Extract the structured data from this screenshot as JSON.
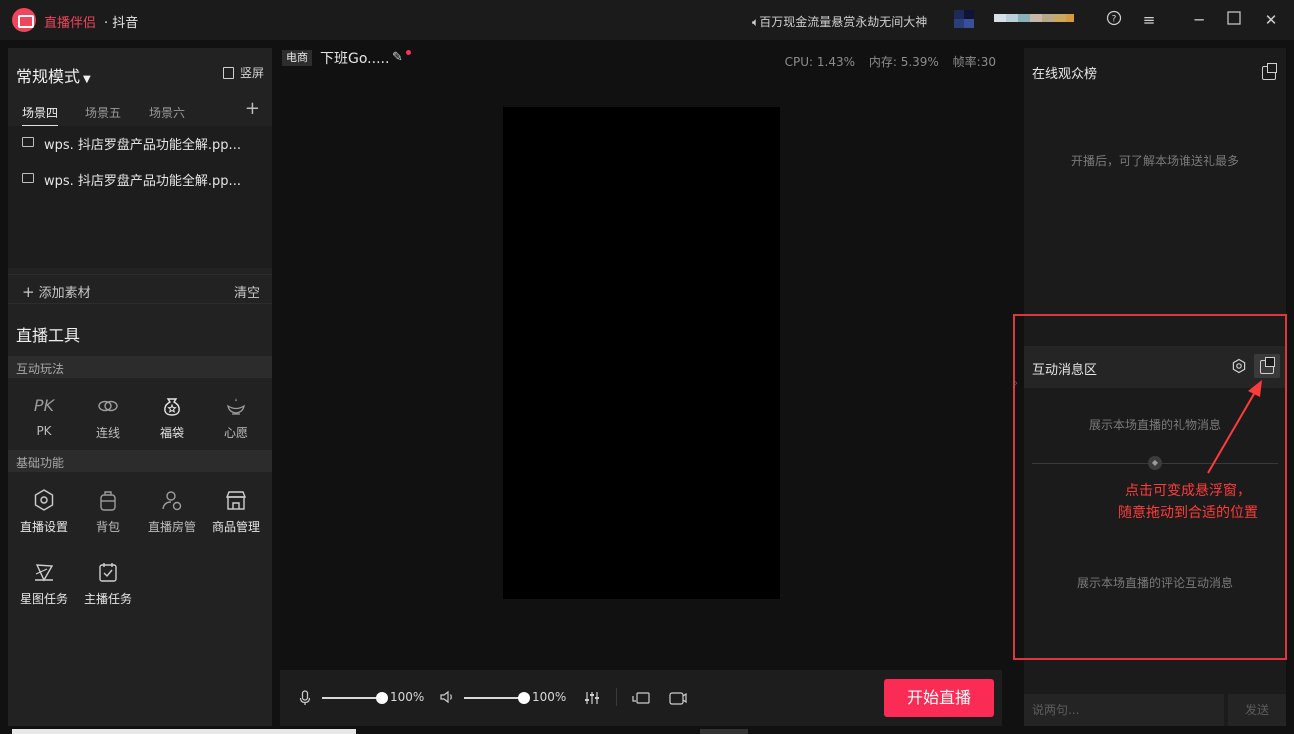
{
  "titlebar": {
    "app_name": "直播伴侣",
    "app_sub": "· 抖音",
    "marquee": "百万现金流量悬赏永劫无间大神"
  },
  "left": {
    "mode": "常规模式",
    "portrait": "竖屏",
    "tabs": [
      "场景四",
      "场景五",
      "场景六"
    ],
    "scenes": [
      "wps. 抖店罗盘产品功能全解.pp...",
      "wps. 抖店罗盘产品功能全解.pp..."
    ],
    "add_material": "添加素材",
    "clear": "清空",
    "tools_title": "直播工具",
    "interactive_section": "互动玩法",
    "interactive_tools": [
      "PK",
      "连线",
      "福袋",
      "心愿"
    ],
    "basic_section": "基础功能",
    "basic_tools": [
      "直播设置",
      "背包",
      "直播房管",
      "商品管理",
      "星图任务",
      "主播任务"
    ]
  },
  "center": {
    "badge": "电商",
    "room_title": "下班Go.....",
    "cpu": "CPU: 1.43%",
    "memory": "内存: 5.39%",
    "fps": "帧率:30",
    "mic_volume": "100%",
    "speaker_volume": "100%",
    "mic_level": 1.0,
    "speaker_level": 1.0,
    "start_button": "开始直播"
  },
  "right": {
    "audience_title": "在线观众榜",
    "audience_hint": "开播后，可了解本场谁送礼最多",
    "message_title": "互动消息区",
    "gift_hint": "展示本场直播的礼物消息",
    "comment_hint": "展示本场直播的评论互动消息",
    "input_placeholder": "说两句...",
    "send": "发送"
  },
  "annotation": {
    "line1": "点击可变成悬浮窗，",
    "line2": "随意拖动到合适的位置"
  },
  "colors": {
    "accent": "#fa2c55",
    "annotation": "#ff3b3b",
    "background": "#111111",
    "panel": "#222222"
  }
}
